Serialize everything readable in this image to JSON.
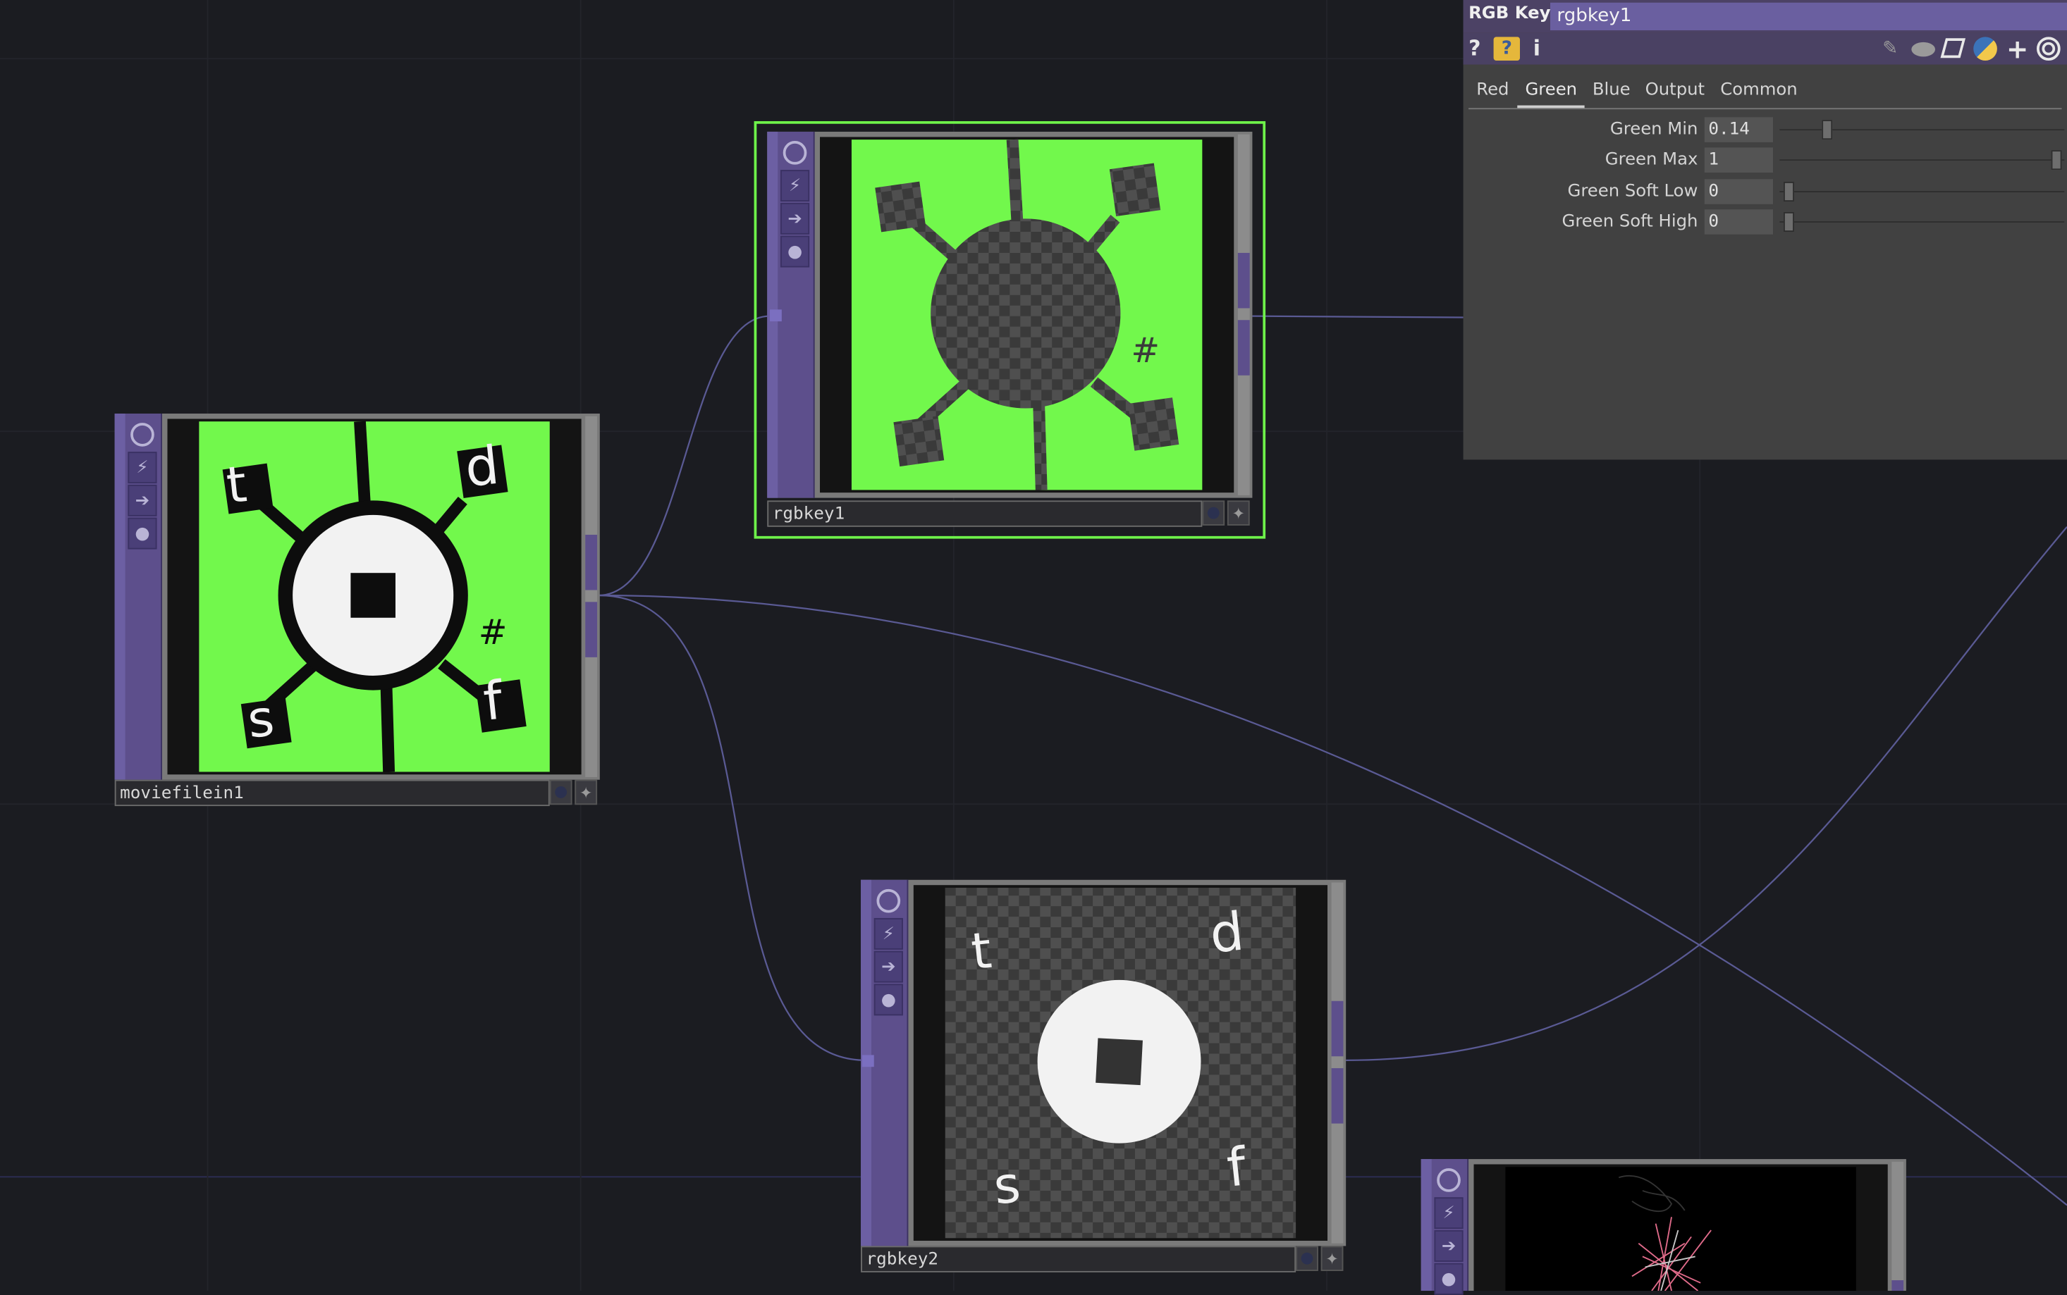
{
  "panel": {
    "op_type": "RGB Key",
    "op_name": "rgbkey1",
    "icons": [
      "help-icon",
      "python-help-icon",
      "info-icon",
      "edit-icon",
      "comment-icon",
      "clone-icon",
      "python-icon",
      "add-icon",
      "target-icon"
    ],
    "help_glyph": "?",
    "info_glyph": "i",
    "add_glyph": "+",
    "tabs": [
      "Red",
      "Green",
      "Blue",
      "Output",
      "Common"
    ],
    "active_tab": "Green",
    "params": [
      {
        "label": "Green Min",
        "value": "0.14",
        "slider_fraction": 0.14
      },
      {
        "label": "Green Max",
        "value": "1",
        "slider_fraction": 1.0
      },
      {
        "label": "Green Soft Low",
        "value": "0",
        "slider_fraction": 0.0
      },
      {
        "label": "Green Soft High",
        "value": "0",
        "slider_fraction": 0.0
      }
    ]
  },
  "nodes": {
    "moviefilein1": {
      "name": "moviefilein1"
    },
    "rgbkey1": {
      "name": "rgbkey1",
      "selected": true
    },
    "rgbkey2": {
      "name": "rgbkey2"
    },
    "node4": {
      "name": ""
    }
  },
  "image_letters": {
    "t": "t",
    "d": "d",
    "s": "s",
    "f": "f",
    "hash": "#"
  },
  "colors": {
    "background": "#1b1c21",
    "key_green": "#72f84c",
    "node_purple": "#5d4f8c",
    "selection_green": "#6ef24a",
    "wire": "#5a5a94"
  }
}
